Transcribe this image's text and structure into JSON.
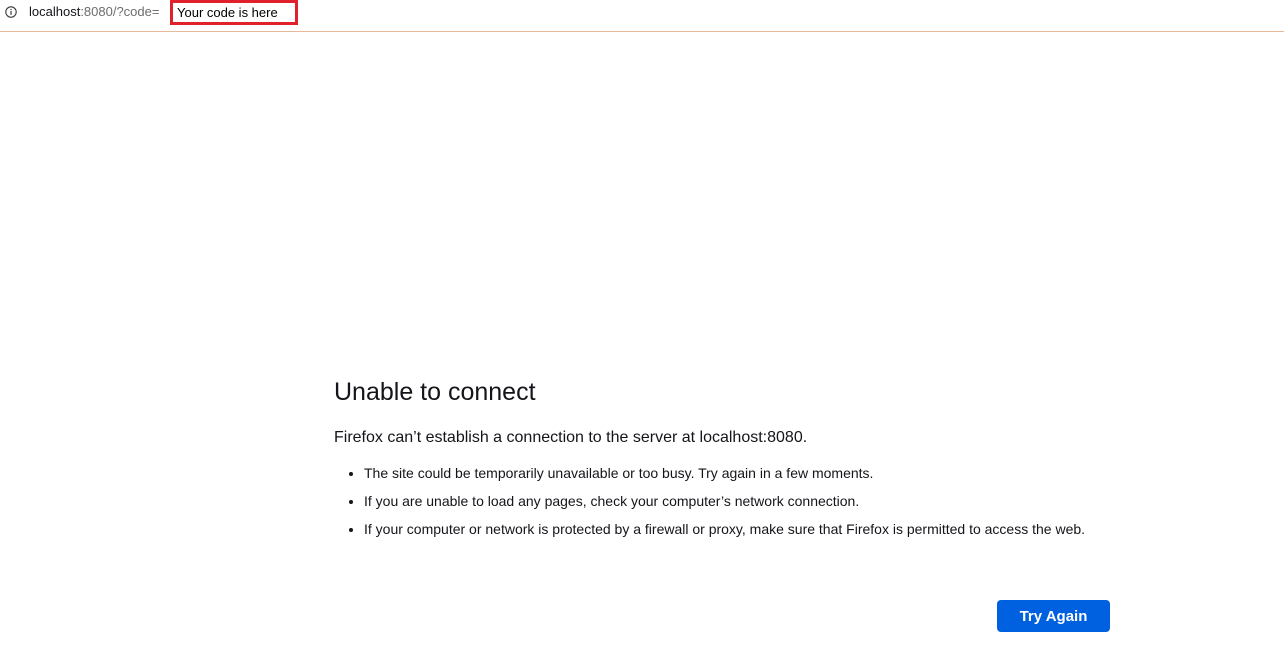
{
  "urlbar": {
    "host": "localhost",
    "rest": ":8080/?code=",
    "code_value": "Your code is here",
    "highlight_color": "#e0202a"
  },
  "error": {
    "title": "Unable to connect",
    "description": "Firefox can’t establish a connection to the server at localhost:8080.",
    "bullets": [
      "The site could be temporarily unavailable or too busy. Try again in a few moments.",
      "If you are unable to load any pages, check your computer’s network connection.",
      "If your computer or network is protected by a firewall or proxy, make sure that Firefox is permitted to access the web."
    ],
    "button_label": "Try Again",
    "button_color": "#0061e0"
  },
  "icons": {
    "site_info": "info-icon"
  }
}
